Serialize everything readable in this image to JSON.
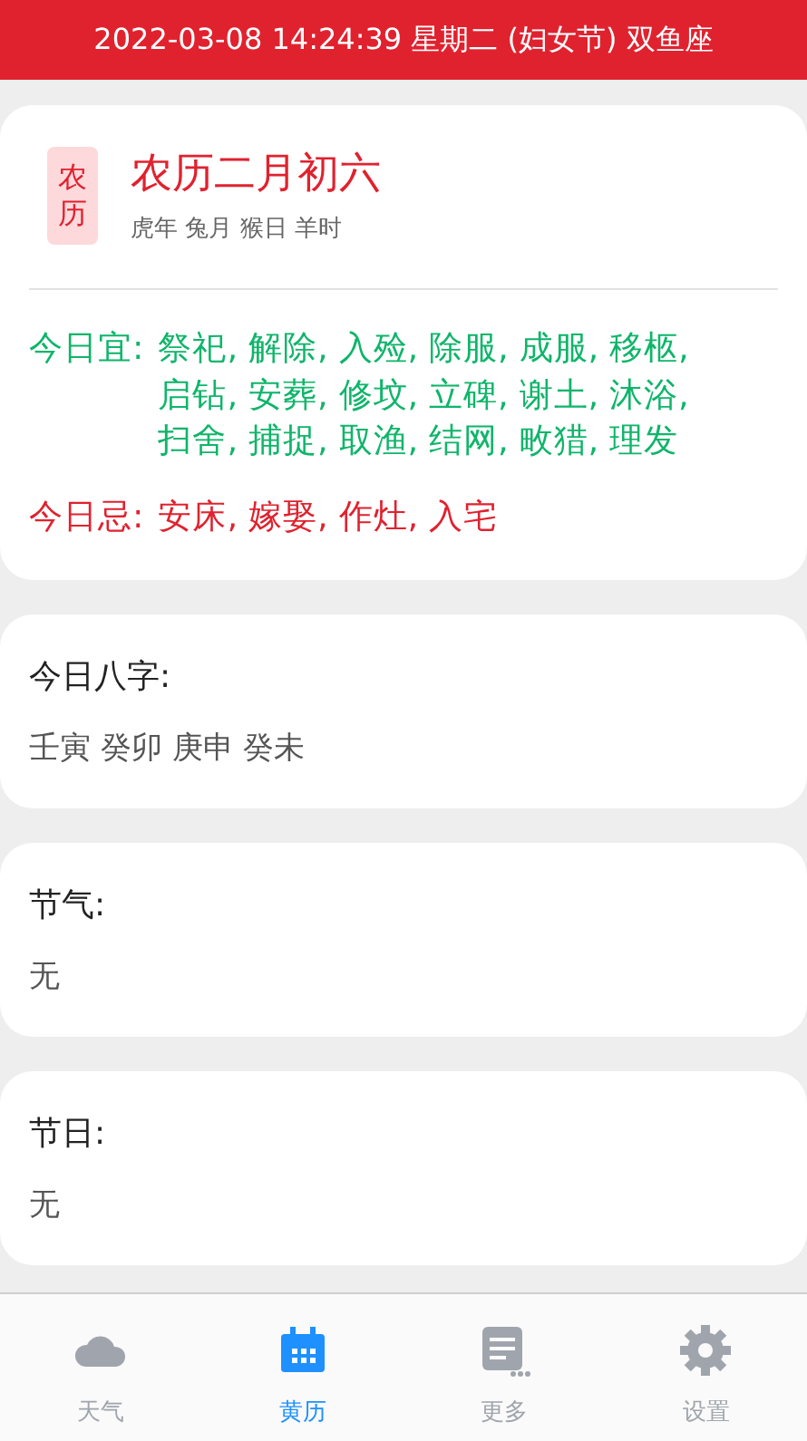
{
  "status_bar": {
    "text": "2022-03-08 14:24:39 星期二 (妇女节) 双鱼座"
  },
  "lunar": {
    "badge": "农历",
    "title": "农历二月初六",
    "subtitle": "虎年 兔月 猴日 羊时",
    "advice": [
      {
        "kind": "good",
        "label": "今日宜:",
        "items": "祭祀, 解除, 入殓, 除服, 成服, 移柩, 启钻, 安葬, 修坟, 立碑, 谢土, 沐浴, 扫舍, 捕捉, 取渔, 结网, 畋猎, 理发"
      },
      {
        "kind": "bad",
        "label": "今日忌:",
        "items": "安床, 嫁娶, 作灶, 入宅"
      }
    ]
  },
  "sections": [
    {
      "title": "今日八字:",
      "value": "壬寅 癸卯 庚申 癸未"
    },
    {
      "title": "节气:",
      "value": "无"
    },
    {
      "title": "节日:",
      "value": "无"
    }
  ],
  "tab_bar": [
    {
      "label": "天气",
      "kind": "cloud",
      "selected": false
    },
    {
      "label": "黄历",
      "kind": "calendar",
      "selected": true
    },
    {
      "label": "更多",
      "kind": "notes",
      "selected": false
    },
    {
      "label": "设置",
      "kind": "gear",
      "selected": false
    }
  ]
}
